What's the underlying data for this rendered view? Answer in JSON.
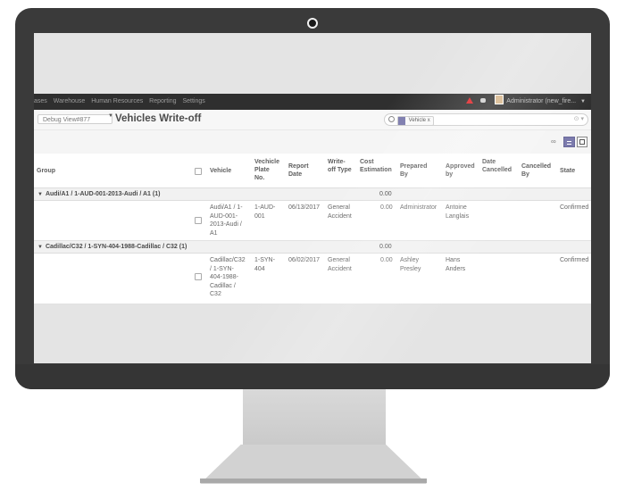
{
  "navbar": {
    "items": [
      "ases",
      "Warehouse",
      "Human Resources",
      "Reporting",
      "Settings"
    ],
    "user_label": "Administrator (new_fire..."
  },
  "control": {
    "debug_select": "Debug View#877",
    "title": "Vehicles Write-off",
    "search_facet": "Vehicle",
    "search_facet_close": "x"
  },
  "table": {
    "headers": {
      "group": "Group",
      "vehicle": "Vehicle",
      "plate": "Vechicle\nPlate\nNo.",
      "report_date": "Report\nDate",
      "write_off_type": "Write-\noff Type",
      "cost": "Cost\nEstimation",
      "prepared_by": "Prepared\nBy",
      "approved_by": "Approved\nby",
      "date_cancelled": "Date\nCancelled",
      "cancelled_by": "Cancelled\nBy",
      "state": "State"
    },
    "groups": [
      {
        "label": "Audi/A1 / 1-AUD-001-2013-Audi / A1 (1)",
        "total": "0.00",
        "row": {
          "vehicle": "Audi/A1 / 1-\nAUD-001-\n2013-Audi /\nA1",
          "plate": "1-AUD-\n001",
          "report_date": "06/13/2017",
          "write_off_type": "General\nAccident",
          "cost": "0.00",
          "prepared_by": "Administrator",
          "approved_by": "Antoine\nLanglais",
          "date_cancelled": "",
          "cancelled_by": "",
          "state": "Confirmed"
        }
      },
      {
        "label": "Cadillac/C32 / 1-SYN-404-1988-Cadillac / C32 (1)",
        "total": "0.00",
        "row": {
          "vehicle": "Cadillac/C32\n/ 1-SYN-\n404-1988-\nCadillac /\nC32",
          "plate": "1-SYN-\n404",
          "report_date": "06/02/2017",
          "write_off_type": "General\nAccident",
          "cost": "0.00",
          "prepared_by": "Ashley\nPresley",
          "approved_by": "Hans\nAnders",
          "date_cancelled": "",
          "cancelled_by": "",
          "state": "Confirmed"
        }
      }
    ]
  },
  "colors": {
    "navbar": "#2f2f2f",
    "accent": "#7c7bad",
    "alert": "#e0272b",
    "monitor_bezel": "#3a3a3a"
  }
}
